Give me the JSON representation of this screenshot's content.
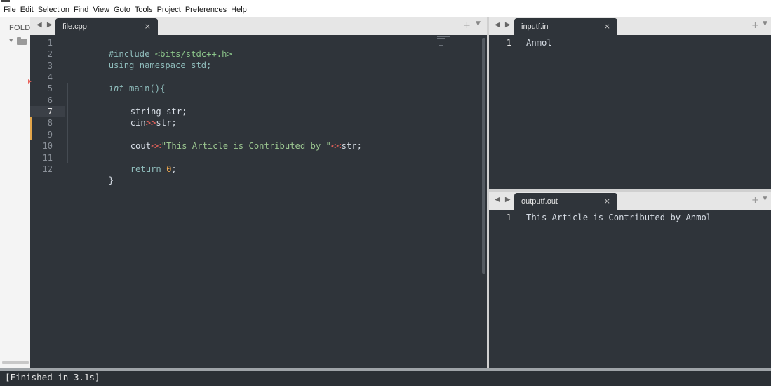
{
  "menubar": {
    "items": [
      "File",
      "Edit",
      "Selection",
      "Find",
      "View",
      "Goto",
      "Tools",
      "Project",
      "Preferences",
      "Help"
    ]
  },
  "sidebar": {
    "title": "FOLD"
  },
  "main_pane": {
    "tab": {
      "label": "file.cpp",
      "close": "×"
    },
    "nav": "◀ ▶",
    "plus": "+",
    "menu": "▼",
    "active_line": 7,
    "lines": [
      {
        "num": "1"
      },
      {
        "num": "2"
      },
      {
        "num": "3"
      },
      {
        "num": "4"
      },
      {
        "num": "5"
      },
      {
        "num": "6"
      },
      {
        "num": "7"
      },
      {
        "num": "8"
      },
      {
        "num": "9"
      },
      {
        "num": "10"
      },
      {
        "num": "11"
      },
      {
        "num": "12"
      }
    ],
    "code": {
      "l1_pp": "#include ",
      "l1_inc": "<bits/stdc++.h>",
      "l2": "using namespace std;",
      "l4_type": "int",
      "l4_rest": " main(){",
      "l6": "string str;",
      "l7_a": "cin",
      "l7_op": ">>",
      "l7_b": "str;",
      "l9_a": "cout",
      "l9_op1": "<<",
      "l9_str": "\"This Article is Contributed by \"",
      "l9_op2": "<<",
      "l9_b": "str;",
      "l11_kw": "return ",
      "l11_num": "0",
      "l11_end": ";",
      "l12": "}"
    }
  },
  "input_pane": {
    "tab": {
      "label": "inputf.in",
      "close": "×"
    },
    "nav": "◀ ▶",
    "plus": "+",
    "menu": "▼",
    "line_num": "1",
    "content": "Anmol"
  },
  "output_pane": {
    "tab": {
      "label": "outputf.out",
      "close": "×"
    },
    "nav": "◀ ▶",
    "plus": "+",
    "menu": "▼",
    "line_num": "1",
    "content": "This Article is Contributed by Anmol"
  },
  "build_output": {
    "text": "[Finished in 3.1s]"
  },
  "colors": {
    "editor_bg": "#2f343a",
    "tab_bar_bg": "#e6e6e6",
    "string": "#9bc690",
    "operator": "#e8625b",
    "number": "#e8a44e",
    "keyword": "#8fbcbb",
    "modified_marker": "#e3a54a"
  }
}
